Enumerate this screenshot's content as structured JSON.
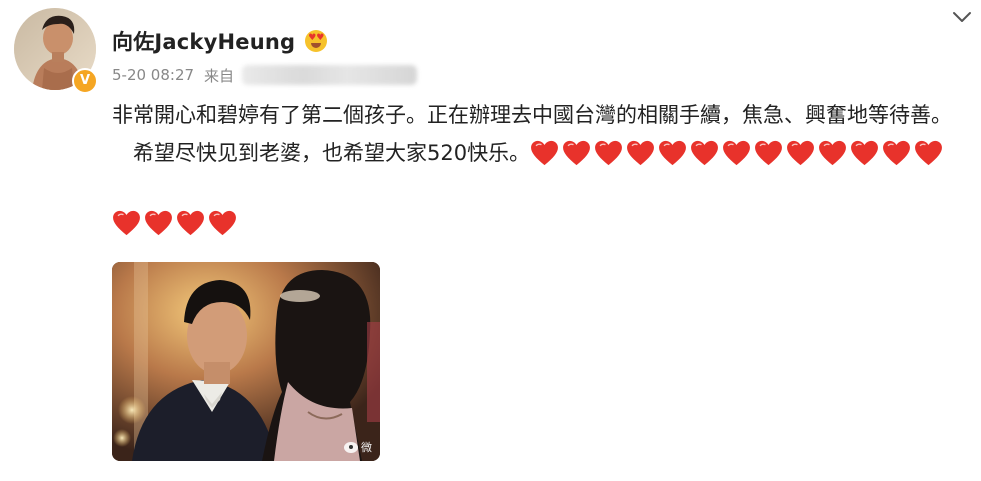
{
  "post": {
    "author": {
      "name": "向佐JackyHeung",
      "verified_badge": "V",
      "name_emoji": "heart-eyes-emoji",
      "avatar": "avatar-photo"
    },
    "meta": {
      "timestamp": "5-20 08:27",
      "source_label": "来自",
      "source_blurred": true
    },
    "text": {
      "paragraph1": "非常開心和碧婷有了第二個孩子。正在辦理去中國台灣的相關手續，焦急、興奮地等待善。",
      "paragraph2": "希望尽快见到老婆，也希望大家520快乐。"
    },
    "hearts": {
      "icon": "red-heart-icon",
      "inline_count": 13,
      "second_row_count": 4,
      "color": "#e8322b"
    },
    "image": {
      "description_icon": "photo-couple-ballroom",
      "watermark_icon": "weibo-watermark-icon"
    },
    "menu": {
      "icon": "chevron-down-icon"
    },
    "colors": {
      "badge": "#f5a623",
      "text": "#222222",
      "meta": "#888888"
    }
  }
}
